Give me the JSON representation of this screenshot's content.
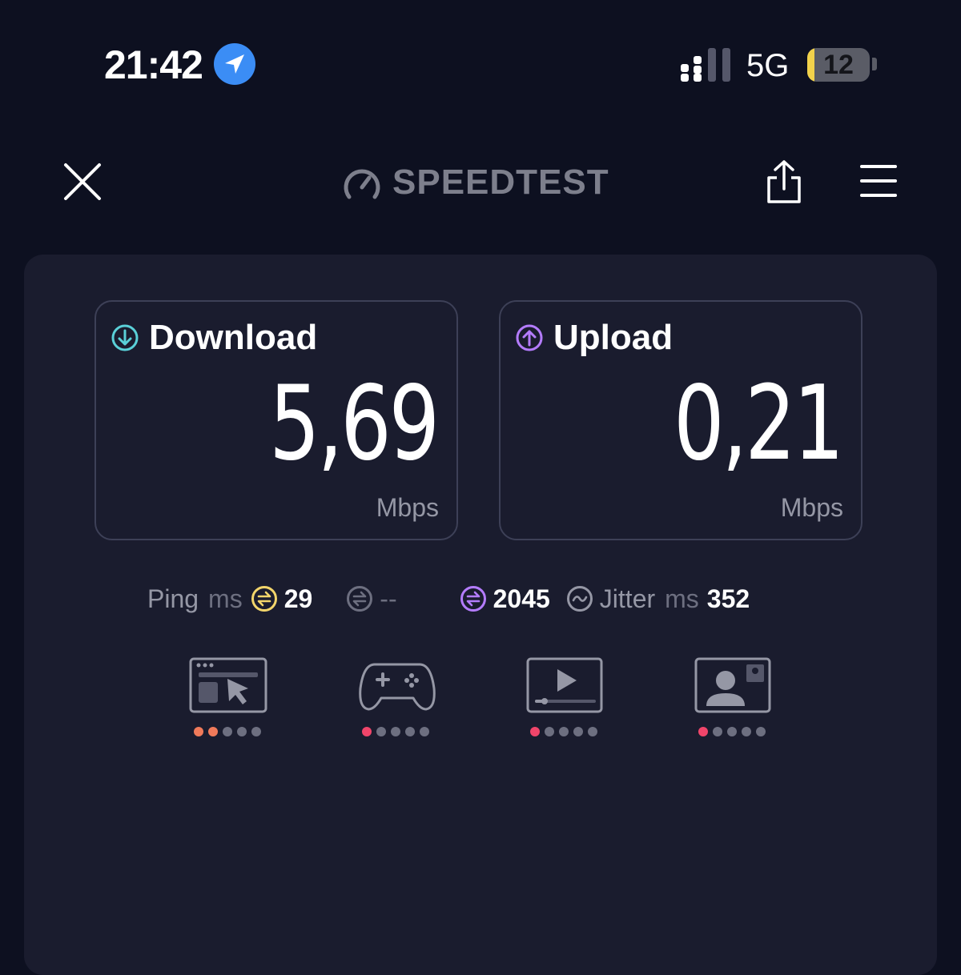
{
  "status_bar": {
    "time": "21:42",
    "network": "5G",
    "battery_level": "12",
    "battery_fraction": 0.12,
    "icons": [
      "location-arrow-icon",
      "cellular-signal-icon",
      "battery-icon"
    ]
  },
  "nav": {
    "brand": "SPEEDTEST",
    "icons": [
      "close-icon",
      "speedometer-logo-icon",
      "share-icon",
      "hamburger-menu-icon"
    ]
  },
  "download": {
    "label": "Download",
    "value": "5,69",
    "unit": "Mbps",
    "color": "#5ad0d8"
  },
  "upload": {
    "label": "Upload",
    "value": "0,21",
    "unit": "Mbps",
    "color": "#b47cff"
  },
  "ping": {
    "label": "Ping",
    "unit": "ms",
    "idle_value": "29",
    "idle_color": "#f2d56b",
    "download_value": "--",
    "upload_value": "2045",
    "upload_color": "#b47cff",
    "jitter_label": "Jitter",
    "jitter_unit": "ms",
    "jitter_value": "352"
  },
  "experiences": [
    {
      "icon": "web-browsing-icon",
      "rating": 2,
      "rating_max": 5,
      "color": "#f07a5a"
    },
    {
      "icon": "gaming-controller-icon",
      "rating": 1,
      "rating_max": 5,
      "color": "#f0456a"
    },
    {
      "icon": "video-streaming-icon",
      "rating": 1,
      "rating_max": 5,
      "color": "#f0456a"
    },
    {
      "icon": "video-call-icon",
      "rating": 1,
      "rating_max": 5,
      "color": "#f0456a"
    }
  ],
  "colors": {
    "background": "#0d1020",
    "panel": "#1a1c2e",
    "muted_text": "#9597a5",
    "dot_inactive": "#6d6f80"
  }
}
